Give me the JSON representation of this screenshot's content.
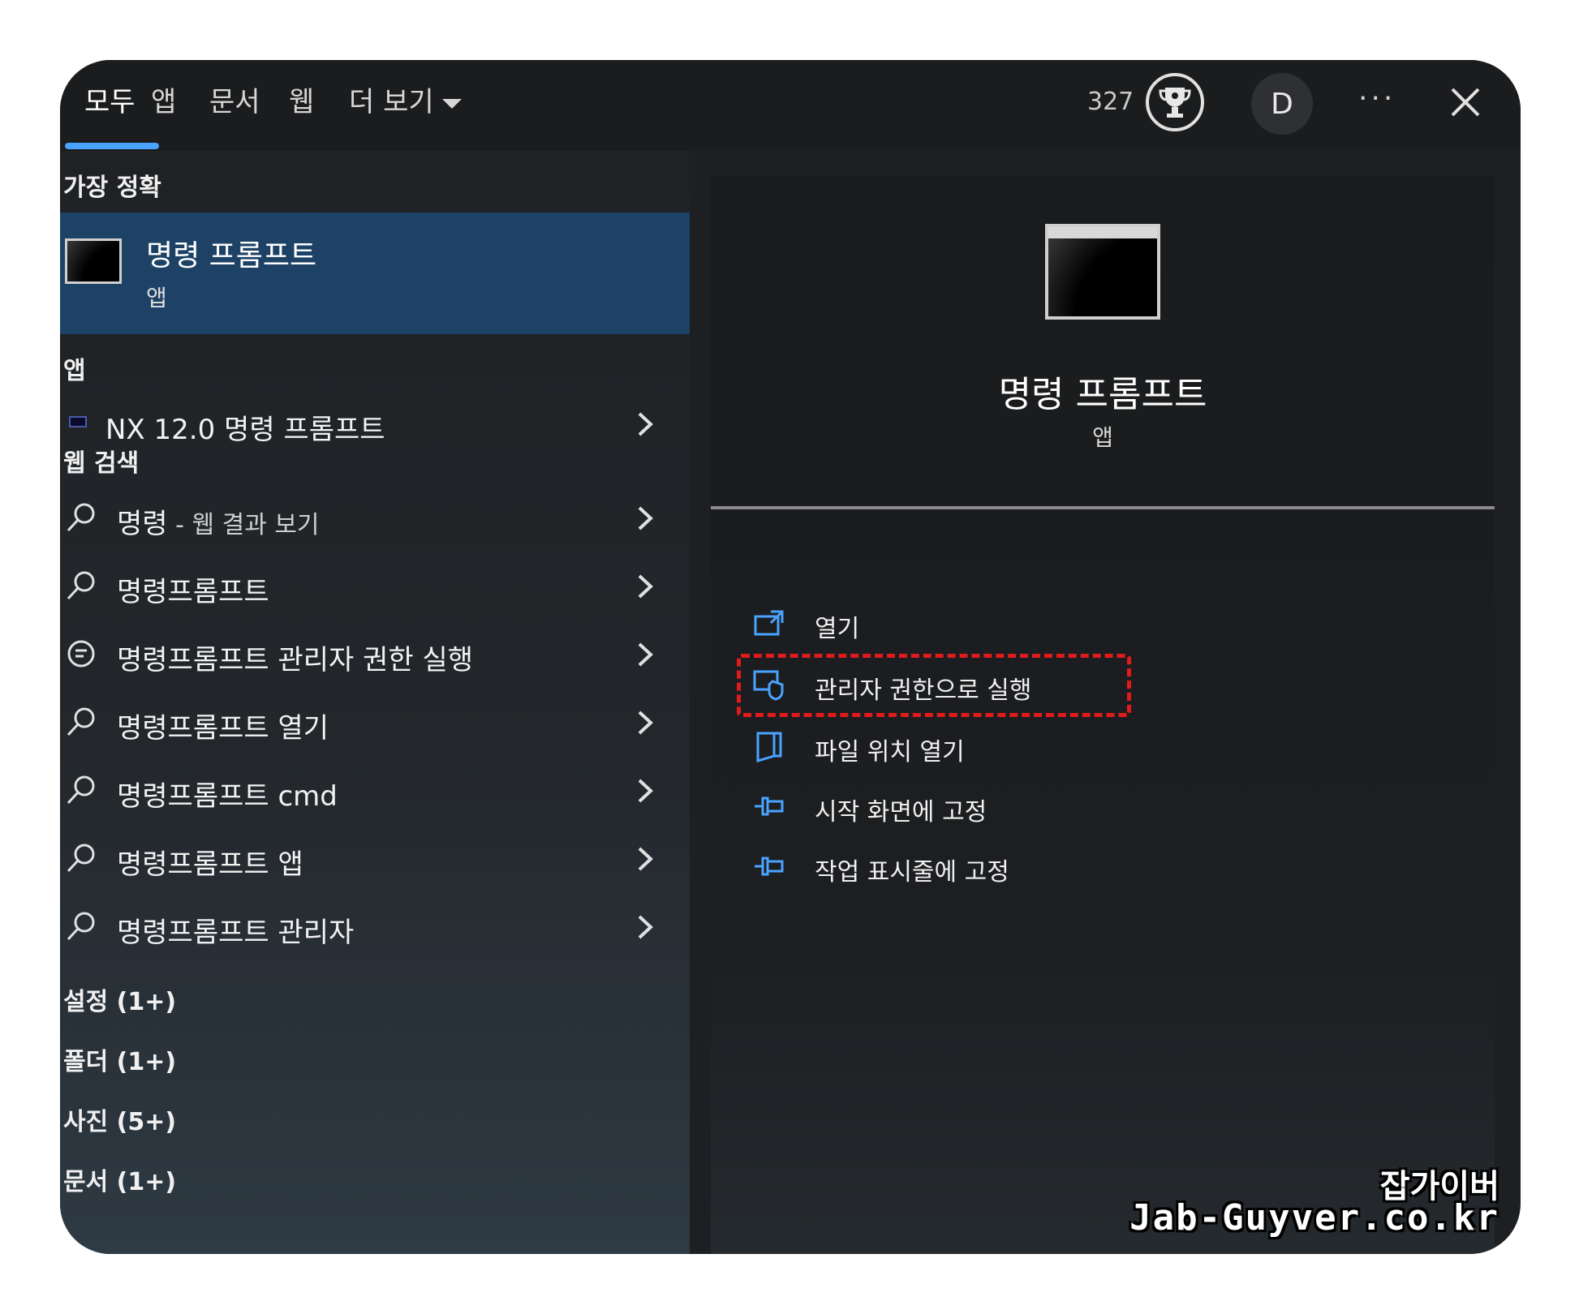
{
  "tabs": [
    {
      "label": "모두",
      "active": true
    },
    {
      "label": "앱"
    },
    {
      "label": "문서"
    },
    {
      "label": "웹"
    },
    {
      "label": "더 보기"
    }
  ],
  "header": {
    "points": "327",
    "avatar_letter": "D",
    "more_label": "···"
  },
  "left": {
    "best_match_heading": "가장 정확",
    "best_match": {
      "title": "명령 프롬프트",
      "subtitle": "앱"
    },
    "apps_heading": "앱",
    "apps": [
      {
        "label": "NX 12.0 명령 프롬프트"
      }
    ],
    "web_heading": "웹 검색",
    "web_results": [
      {
        "label": "명령",
        "suffix": " - 웹 결과 보기",
        "icon": "search-icon"
      },
      {
        "label": "명령프롬프트",
        "suffix": "",
        "icon": "search-icon"
      },
      {
        "label": "명령프롬프트 관리자 권한 실행",
        "suffix": "",
        "icon": "chat-icon"
      },
      {
        "label": "명령프롬프트 열기",
        "suffix": "",
        "icon": "search-icon"
      },
      {
        "label": "명령프롬프트 cmd",
        "suffix": "",
        "icon": "search-icon"
      },
      {
        "label": "명령프롬프트 앱",
        "suffix": "",
        "icon": "search-icon"
      },
      {
        "label": "명령프롬프트 관리자",
        "suffix": "",
        "icon": "search-icon"
      }
    ],
    "categories": [
      "설정 (1+)",
      "폴더 (1+)",
      "사진 (5+)",
      "문서 (1+)"
    ]
  },
  "right": {
    "title": "명령 프롬프트",
    "subtitle": "앱",
    "actions": [
      {
        "label": "열기",
        "icon": "open-icon"
      },
      {
        "label": "관리자 권한으로 실행",
        "icon": "shield-icon"
      },
      {
        "label": "파일 위치 열기",
        "icon": "folder-icon"
      },
      {
        "label": "시작 화면에 고정",
        "icon": "pin-icon"
      },
      {
        "label": "작업 표시줄에 고정",
        "icon": "pin-icon"
      }
    ]
  },
  "watermark": {
    "line1": "잡가이버",
    "line2": "Jab-Guyver.co.kr"
  },
  "colors": {
    "accent": "#4aa3ff",
    "selection": "#1d4266",
    "highlight_box": "#e01b1b"
  }
}
